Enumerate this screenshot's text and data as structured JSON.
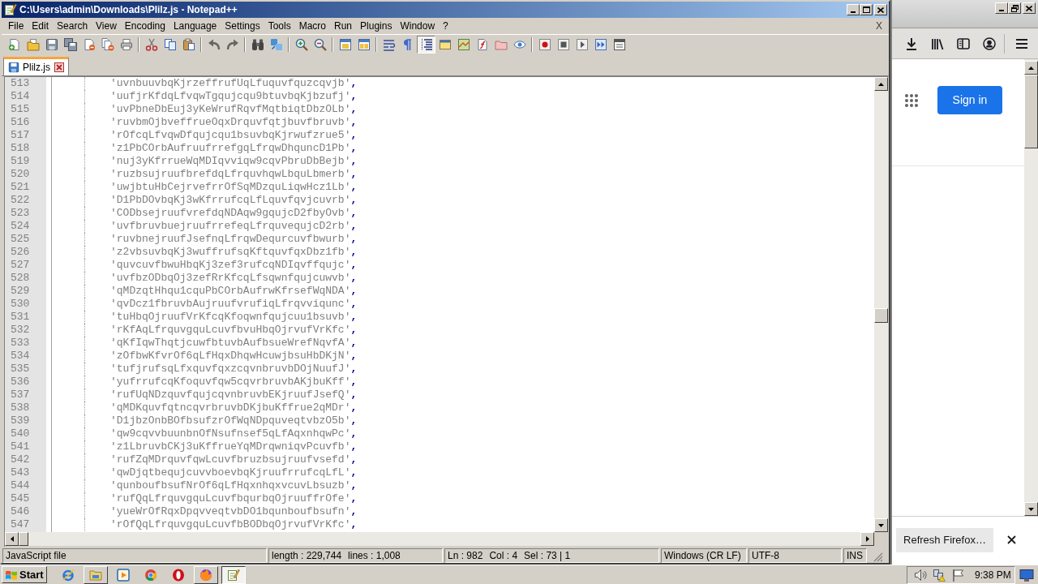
{
  "notepad_window": {
    "title": "C:\\Users\\admin\\Downloads\\Plilz.js - Notepad++",
    "menu": [
      "File",
      "Edit",
      "Search",
      "View",
      "Encoding",
      "Language",
      "Settings",
      "Tools",
      "Macro",
      "Run",
      "Plugins",
      "Window",
      "?"
    ],
    "menu_close": "X",
    "toolbar": [
      [
        {
          "kind": "new",
          "pressed": false
        },
        {
          "kind": "open",
          "pressed": false
        },
        {
          "kind": "save",
          "pressed": false
        },
        {
          "kind": "saveall",
          "pressed": false
        },
        {
          "kind": "close",
          "pressed": false
        },
        {
          "kind": "closeall",
          "pressed": false
        },
        {
          "kind": "print",
          "pressed": false
        }
      ],
      [
        {
          "kind": "cut",
          "pressed": false
        },
        {
          "kind": "copy",
          "pressed": false
        },
        {
          "kind": "paste",
          "pressed": false
        }
      ],
      [
        {
          "kind": "undo",
          "pressed": false
        },
        {
          "kind": "redo",
          "pressed": false
        }
      ],
      [
        {
          "kind": "find",
          "pressed": false
        },
        {
          "kind": "replace",
          "pressed": false
        }
      ],
      [
        {
          "kind": "zoomin",
          "pressed": false
        },
        {
          "kind": "zoomout",
          "pressed": false
        }
      ],
      [
        {
          "kind": "syncv",
          "pressed": false
        },
        {
          "kind": "synch",
          "pressed": false
        }
      ],
      [
        {
          "kind": "wrap",
          "pressed": false
        },
        {
          "kind": "allchars",
          "pressed": false
        },
        {
          "kind": "indent",
          "pressed": true
        },
        {
          "kind": "udl",
          "pressed": false
        },
        {
          "kind": "map",
          "pressed": false
        },
        {
          "kind": "funclist",
          "pressed": false
        },
        {
          "kind": "folder",
          "pressed": false
        },
        {
          "kind": "monitor",
          "pressed": false
        }
      ],
      [
        {
          "kind": "record",
          "pressed": false
        },
        {
          "kind": "stop",
          "pressed": false
        },
        {
          "kind": "play",
          "pressed": false
        },
        {
          "kind": "playmulti",
          "pressed": false
        },
        {
          "kind": "savemacro",
          "pressed": false
        }
      ]
    ],
    "tabs": [
      {
        "label": "Plilz.js",
        "selected": true
      }
    ],
    "editor": {
      "lines": [
        {
          "number": "513",
          "text": "'uvnbuuvbqKjrzeffrufUqLfuquvfquzcqvjb',"
        },
        {
          "number": "514",
          "text": "'uufjrKfdqLfvqwTgqujcqu9btuvbqKjbzufj',"
        },
        {
          "number": "515",
          "text": "'uvPbneDbEuj3yKeWrufRqvfMqtbiqtDbzOLb',"
        },
        {
          "number": "516",
          "text": "'ruvbmOjbveffrueOqxDrquvfqtjbuvfbruvb',"
        },
        {
          "number": "517",
          "text": "'rOfcqLfvqwDfqujcqu1bsuvbqKjrwufzrue5',"
        },
        {
          "number": "518",
          "text": "'z1PbCOrbAufruufrrefgqLfrqwDhquncD1Pb',"
        },
        {
          "number": "519",
          "text": "'nuj3yKfrrueWqMDIqvviqw9cqvPbruDbBejb',"
        },
        {
          "number": "520",
          "text": "'ruzbsujruufbrefdqLfrquvhqwLbquLbmerb',"
        },
        {
          "number": "521",
          "text": "'uwjbtuHbCejrvefrrOfSqMDzquLiqwHcz1Lb',"
        },
        {
          "number": "522",
          "text": "'D1PbDOvbqKj3wKfrrufcqLfLquvfqvjcuvrb',"
        },
        {
          "number": "523",
          "text": "'CODbsejruufvrefdqNDAqw9gqujcD2fbyOvb',"
        },
        {
          "number": "524",
          "text": "'uvfbruvbuejruufrrefeqLfrquvequjcD2rb',"
        },
        {
          "number": "525",
          "text": "'ruvbnejruufJsefnqLfrqwDequrcuvfbwurb',"
        },
        {
          "number": "526",
          "text": "'z2vbsuvbqKj3wuffrufsqKftquvfqxDbz1fb',"
        },
        {
          "number": "527",
          "text": "'quvcuvfbwuHbqKj3zef3rufcqNDIqvffqujc',"
        },
        {
          "number": "528",
          "text": "'uvfbzODbqOj3zefRrKfcqLfsqwnfqujcuwvb',"
        },
        {
          "number": "529",
          "text": "'qMDzqtHhqu1cquPbCOrbAufrwKfrsefWqNDA',"
        },
        {
          "number": "530",
          "text": "'qvDcz1fbruvbAujruufvrufiqLfrqvviqunc',"
        },
        {
          "number": "531",
          "text": "'tuHbqOjruufVrKfcqKfoqwnfqujcuu1bsuvb',"
        },
        {
          "number": "532",
          "text": "'rKfAqLfrquvgquLcuvfbvuHbqOjrvufVrKfc',"
        },
        {
          "number": "533",
          "text": "'qKfIqwThqtjcuwfbtuvbAufbsueWrefNqvfA',"
        },
        {
          "number": "534",
          "text": "'zOfbwKfvrOf6qLfHqxDhqwHcuwjbsuHbDKjN',"
        },
        {
          "number": "535",
          "text": "'tufjrufsqLfxquvfqxzcqvnbruvbDOjNuufJ',"
        },
        {
          "number": "536",
          "text": "'yufrrufcqKfoquvfqw5cqvrbruvbAKjbuKff',"
        },
        {
          "number": "537",
          "text": "'rufUqNDzquvfqujcqvnbruvbEKjruufJsefQ',"
        },
        {
          "number": "538",
          "text": "'qMDKquvfqtncqvrbruvbDKjbuKffrue2qMDr',"
        },
        {
          "number": "539",
          "text": "'D1jbzOnbBOfbsufzrOfWqNDpquveqtvbzO5b',"
        },
        {
          "number": "540",
          "text": "'qw9cqvvbuunbnOfNsufnsef5qLfAqxnhqwPc',"
        },
        {
          "number": "541",
          "text": "'z1LbruvbCKj3uKffrueYqMDrqwniqvPcuvfb',"
        },
        {
          "number": "542",
          "text": "'rufZqMDrquvfqwLcuvfbruzbsujruufvsefd',"
        },
        {
          "number": "543",
          "text": "'qwDjqtbequjcuvvboevbqKjruufrrufcqLfL',"
        },
        {
          "number": "544",
          "text": "'qunboufbsufNrOf6qLfHqxnhqxvcuvLbsuzb',"
        },
        {
          "number": "545",
          "text": "'rufQqLfrquvgquLcuvfbqurbqOjruuffrOfe',"
        },
        {
          "number": "546",
          "text": "'yueWrOfRqxDpqvveqtvbDO1bqunboufbsufn',"
        },
        {
          "number": "547",
          "text": "'rOfQqLfrquvgquLcuvfbBODbqOjrvufVrKfc',"
        }
      ]
    },
    "status_bar": [
      {
        "texts": [
          "JavaScript file"
        ]
      },
      {
        "texts": [
          "length : 229,744",
          "lines : 1,008"
        ]
      },
      {
        "texts": [
          "Ln : 982",
          "Col : 4",
          "Sel : 73 | 1"
        ]
      },
      {
        "texts": [
          "Windows (CR LF)"
        ]
      },
      {
        "texts": [
          "UTF-8"
        ]
      },
      {
        "texts": [
          "INS"
        ]
      }
    ]
  },
  "firefox_window": {
    "sign_in_button": "Sign in",
    "notification": "Refresh Firefox…"
  },
  "taskbar": {
    "start": "Start",
    "items": [
      {
        "kind": "ie",
        "running": false,
        "selected": false
      },
      {
        "kind": "explorer",
        "running": true,
        "selected": false
      },
      {
        "kind": "media",
        "running": false,
        "selected": false
      },
      {
        "kind": "chrome",
        "running": false,
        "selected": false
      },
      {
        "kind": "opera",
        "running": false,
        "selected": false
      },
      {
        "kind": "firefox",
        "running": true,
        "selected": false
      },
      {
        "kind": "notepad",
        "running": true,
        "selected": true
      }
    ],
    "clock": "9:38 PM"
  }
}
